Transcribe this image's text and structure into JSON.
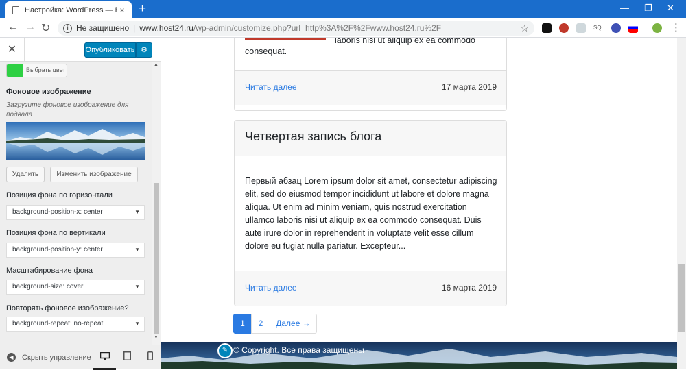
{
  "browser": {
    "tab_title": "Настройка: WordPress — Ещё о",
    "new_tab": "+",
    "tab_close": "×",
    "win_min": "—",
    "win_restore": "❐",
    "win_close": "✕",
    "not_secure": "Не защищено",
    "url_host": "www.host24.ru",
    "url_path": "/wp-admin/customize.php?url=http%3A%2F%2Fwww.host24.ru%2F",
    "back": "←",
    "forward": "→",
    "reload": "↻",
    "star": "☆",
    "ext_sql": "SQL",
    "menu": "⋮"
  },
  "customizer": {
    "close": "✕",
    "publish_label": "Опубликовать",
    "gear": "⚙",
    "select_color_label": "Выбрать цвет",
    "bg_image_heading": "Фоновое изображение",
    "bg_image_desc": "Загрузите фоновое изображение для подвала",
    "remove_button": "Удалить",
    "change_image_button": "Изменить изображение",
    "controls": [
      {
        "label": "Позиция фона по горизонтали",
        "value": "background-position-x: center"
      },
      {
        "label": "Позиция фона по вертикали",
        "value": "background-position-y: center"
      },
      {
        "label": "Масштабирование фона",
        "value": "background-size: cover"
      },
      {
        "label": "Повторять фоновое изображение?",
        "value": "background-repeat: no-repeat"
      }
    ],
    "hide_controls": "Скрыть управление",
    "colors": {
      "accent": "#0085ba",
      "swatch": "#2ed043"
    }
  },
  "preview": {
    "prev_card_text_fragment": "laborls nisl ut aliquip ex ea commodo",
    "prev_card_text_end": "consequat.",
    "prev_card_read_more": "Читать далее",
    "prev_card_date": "17 марта 2019",
    "card": {
      "title": "Четвертая запись блога",
      "body": "Первый абзац Lorem ipsum dolor sit amet, consectetur adipiscing elit, sed do eiusmod tempor incididunt ut labore et dolore magna aliqua. Ut enim ad minim veniam, quis nostrud exercitation ullamco laboris nisi ut aliquip ex ea commodo consequat. Duis aute irure dolor in reprehenderit in voluptate velit esse cillum dolore eu fugiat nulla pariatur. Excepteur...",
      "read_more": "Читать далее",
      "date": "16 марта 2019"
    },
    "pagination": {
      "page1": "1",
      "page2": "2",
      "next": "Далее →"
    },
    "footer_text": "© Copyright. Все права защищены",
    "edit_pen": "✎",
    "colors": {
      "link": "#2a7ae2"
    }
  }
}
